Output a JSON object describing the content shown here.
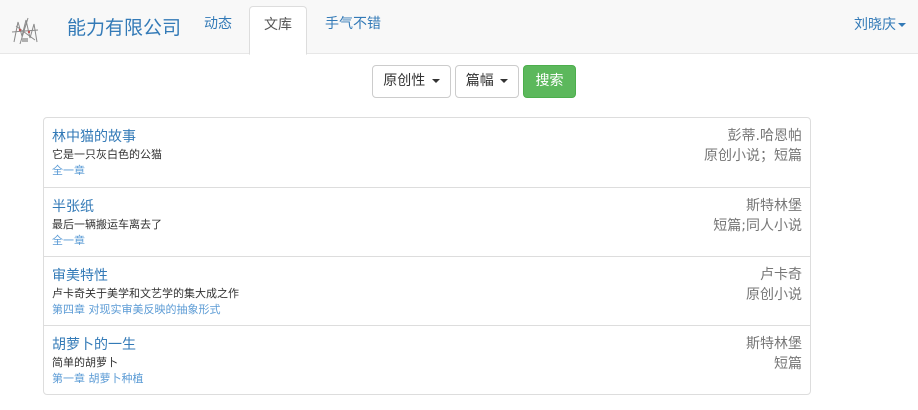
{
  "header": {
    "brand": "能力有限公司",
    "tabs": [
      {
        "label": "动态",
        "active": false
      },
      {
        "label": "文库",
        "active": true
      },
      {
        "label": "手气不错",
        "active": false
      }
    ],
    "user": "刘晓庆"
  },
  "filters": {
    "originality": "原创性",
    "length": "篇幅",
    "search": "搜索"
  },
  "works": [
    {
      "title": "林中猫的故事",
      "desc": "它是一只灰白色的公猫",
      "chapter": "全一章",
      "author": "彭蒂.哈恩帕",
      "tags": "原创小说；短篇"
    },
    {
      "title": "半张纸",
      "desc": "最后一辆搬运车离去了",
      "chapter": "全一章",
      "author": "斯特林堡",
      "tags": "短篇;同人小说"
    },
    {
      "title": "审美特性",
      "desc": "卢卡奇关于美学和文艺学的集大成之作",
      "chapter": "第四章 对现实审美反映的抽象形式",
      "author": "卢卡奇",
      "tags": "原创小说"
    },
    {
      "title": "胡萝卜的一生",
      "desc": "简单的胡萝卜",
      "chapter": "第一章 胡萝卜种植",
      "author": "斯特林堡",
      "tags": "短篇"
    }
  ],
  "colors": {
    "link": "#337ab7",
    "success": "#5cb85c",
    "muted": "#777777"
  },
  "icons": {
    "logo": "sketch-logo-icon",
    "caret": "caret-down-icon"
  }
}
